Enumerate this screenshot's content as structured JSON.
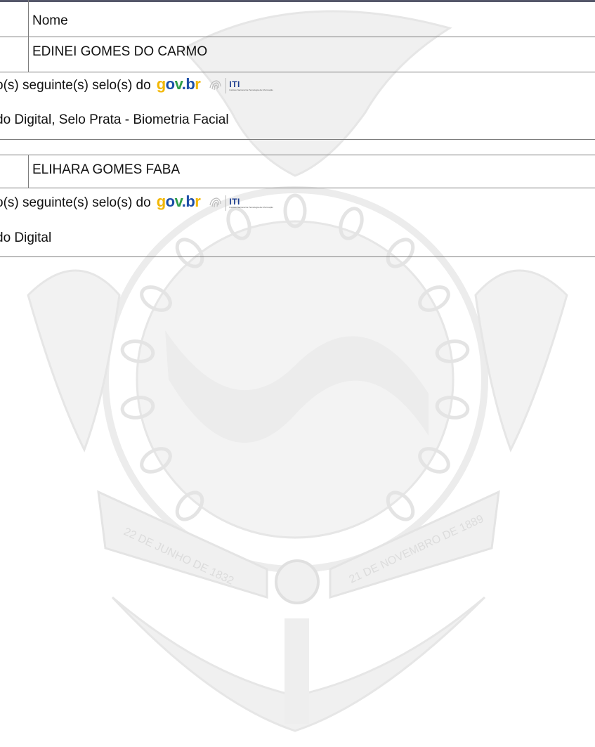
{
  "signers": [
    {
      "header_label": "Nome",
      "name": "EDINEI GOMES DO CARMO",
      "seal_intro": "o(s) seguinte(s) selo(s) do",
      "seals": "do Digital, Selo Prata - Biometria Facial"
    },
    {
      "name": "ELIHARA GOMES FABA",
      "seal_intro": "o(s) seguinte(s) selo(s) do",
      "seals": "do Digital"
    }
  ],
  "logos": {
    "govbr_text": "gov.br",
    "iti_text": "ITI",
    "iti_subtitle": "Instituto Nacional de Tecnologia da Informação"
  },
  "watermark": {
    "left_ribbon": "22 DE JUNHO DE 1832",
    "right_ribbon": "21 DE NOVEMBRO DE 1889"
  },
  "colors": {
    "govbr_yellow": "#f2b705",
    "govbr_blue": "#1c4fa8",
    "govbr_green": "#2e9d49",
    "watermark_gray": "#ebebeb"
  }
}
